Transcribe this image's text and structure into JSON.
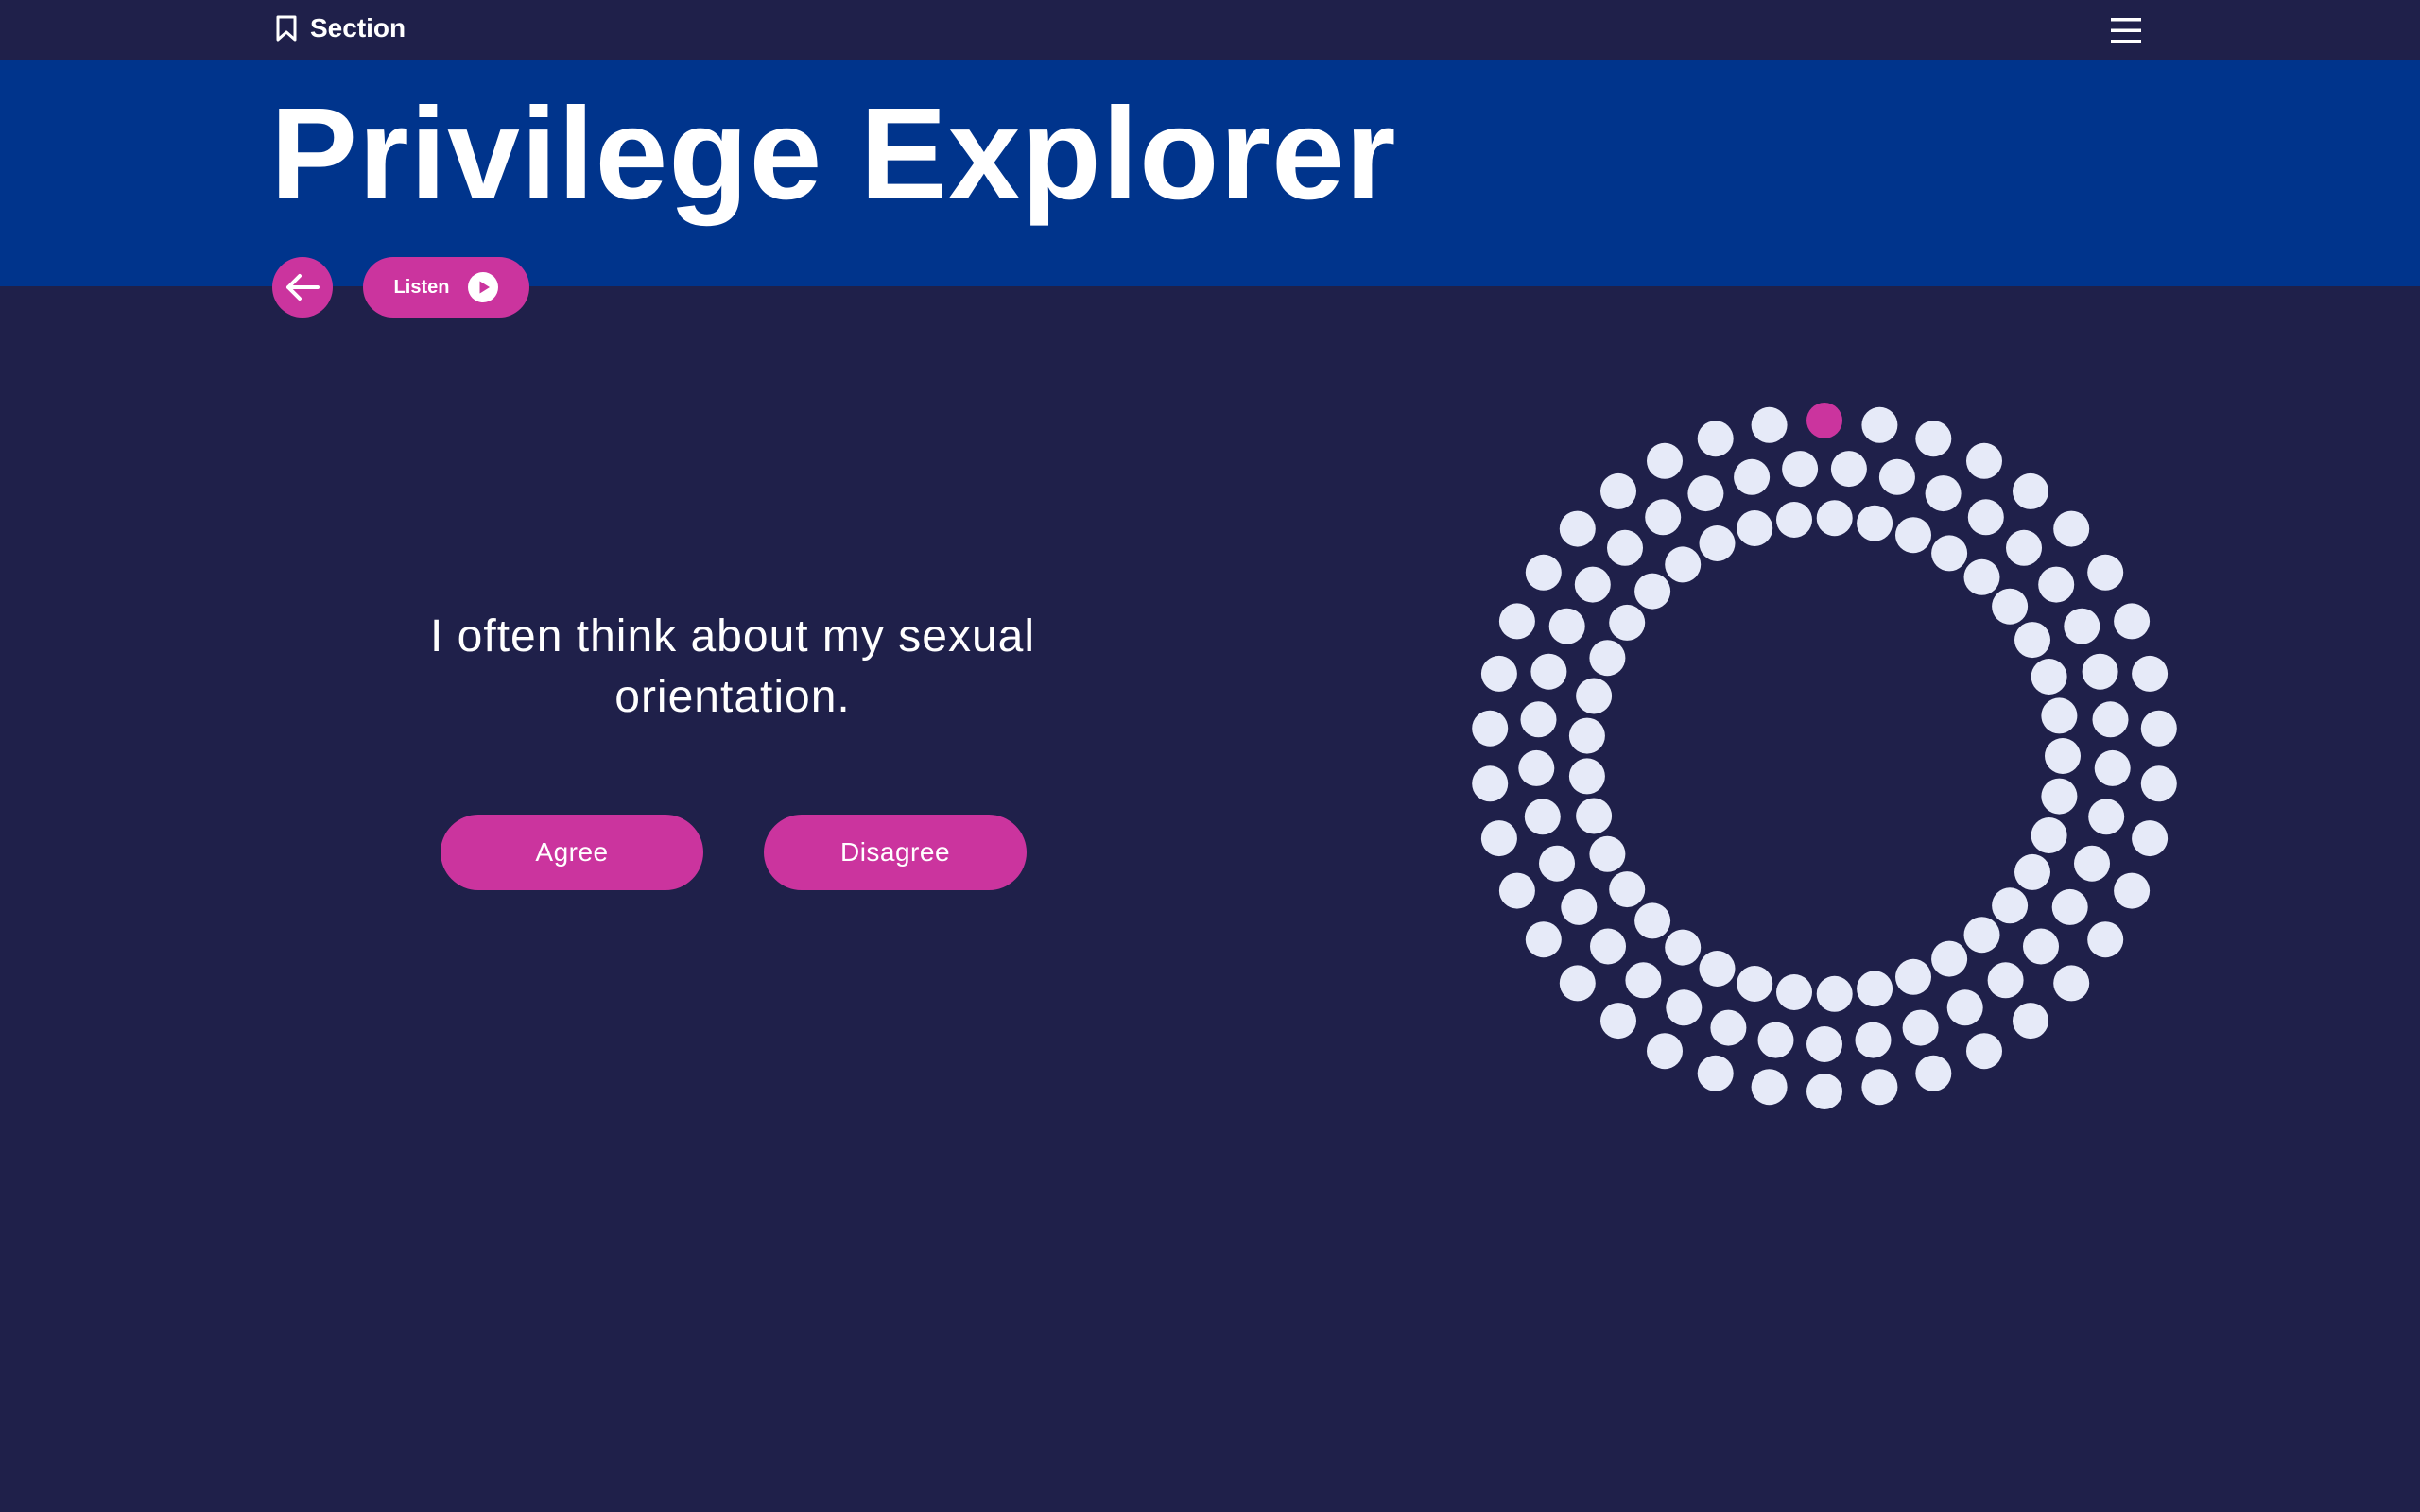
{
  "header": {
    "section_label": "Section",
    "section_icon": "bookmark-icon",
    "menu_icon": "hamburger-menu-icon"
  },
  "hero": {
    "title": "Privilege Explorer",
    "back_icon": "arrow-left-icon",
    "listen_label": "Listen",
    "listen_icon": "play-icon"
  },
  "question": {
    "text": "I often think about my sexual orientation.",
    "agree_label": "Agree",
    "disagree_label": "Disagree"
  },
  "progress": {
    "total_questions": 112,
    "current_index": 0
  },
  "colors": {
    "background": "#1f204a",
    "hero": "#00348c",
    "accent": "#cb349e",
    "dot": "#e6eaf8",
    "text": "#ffffff"
  }
}
